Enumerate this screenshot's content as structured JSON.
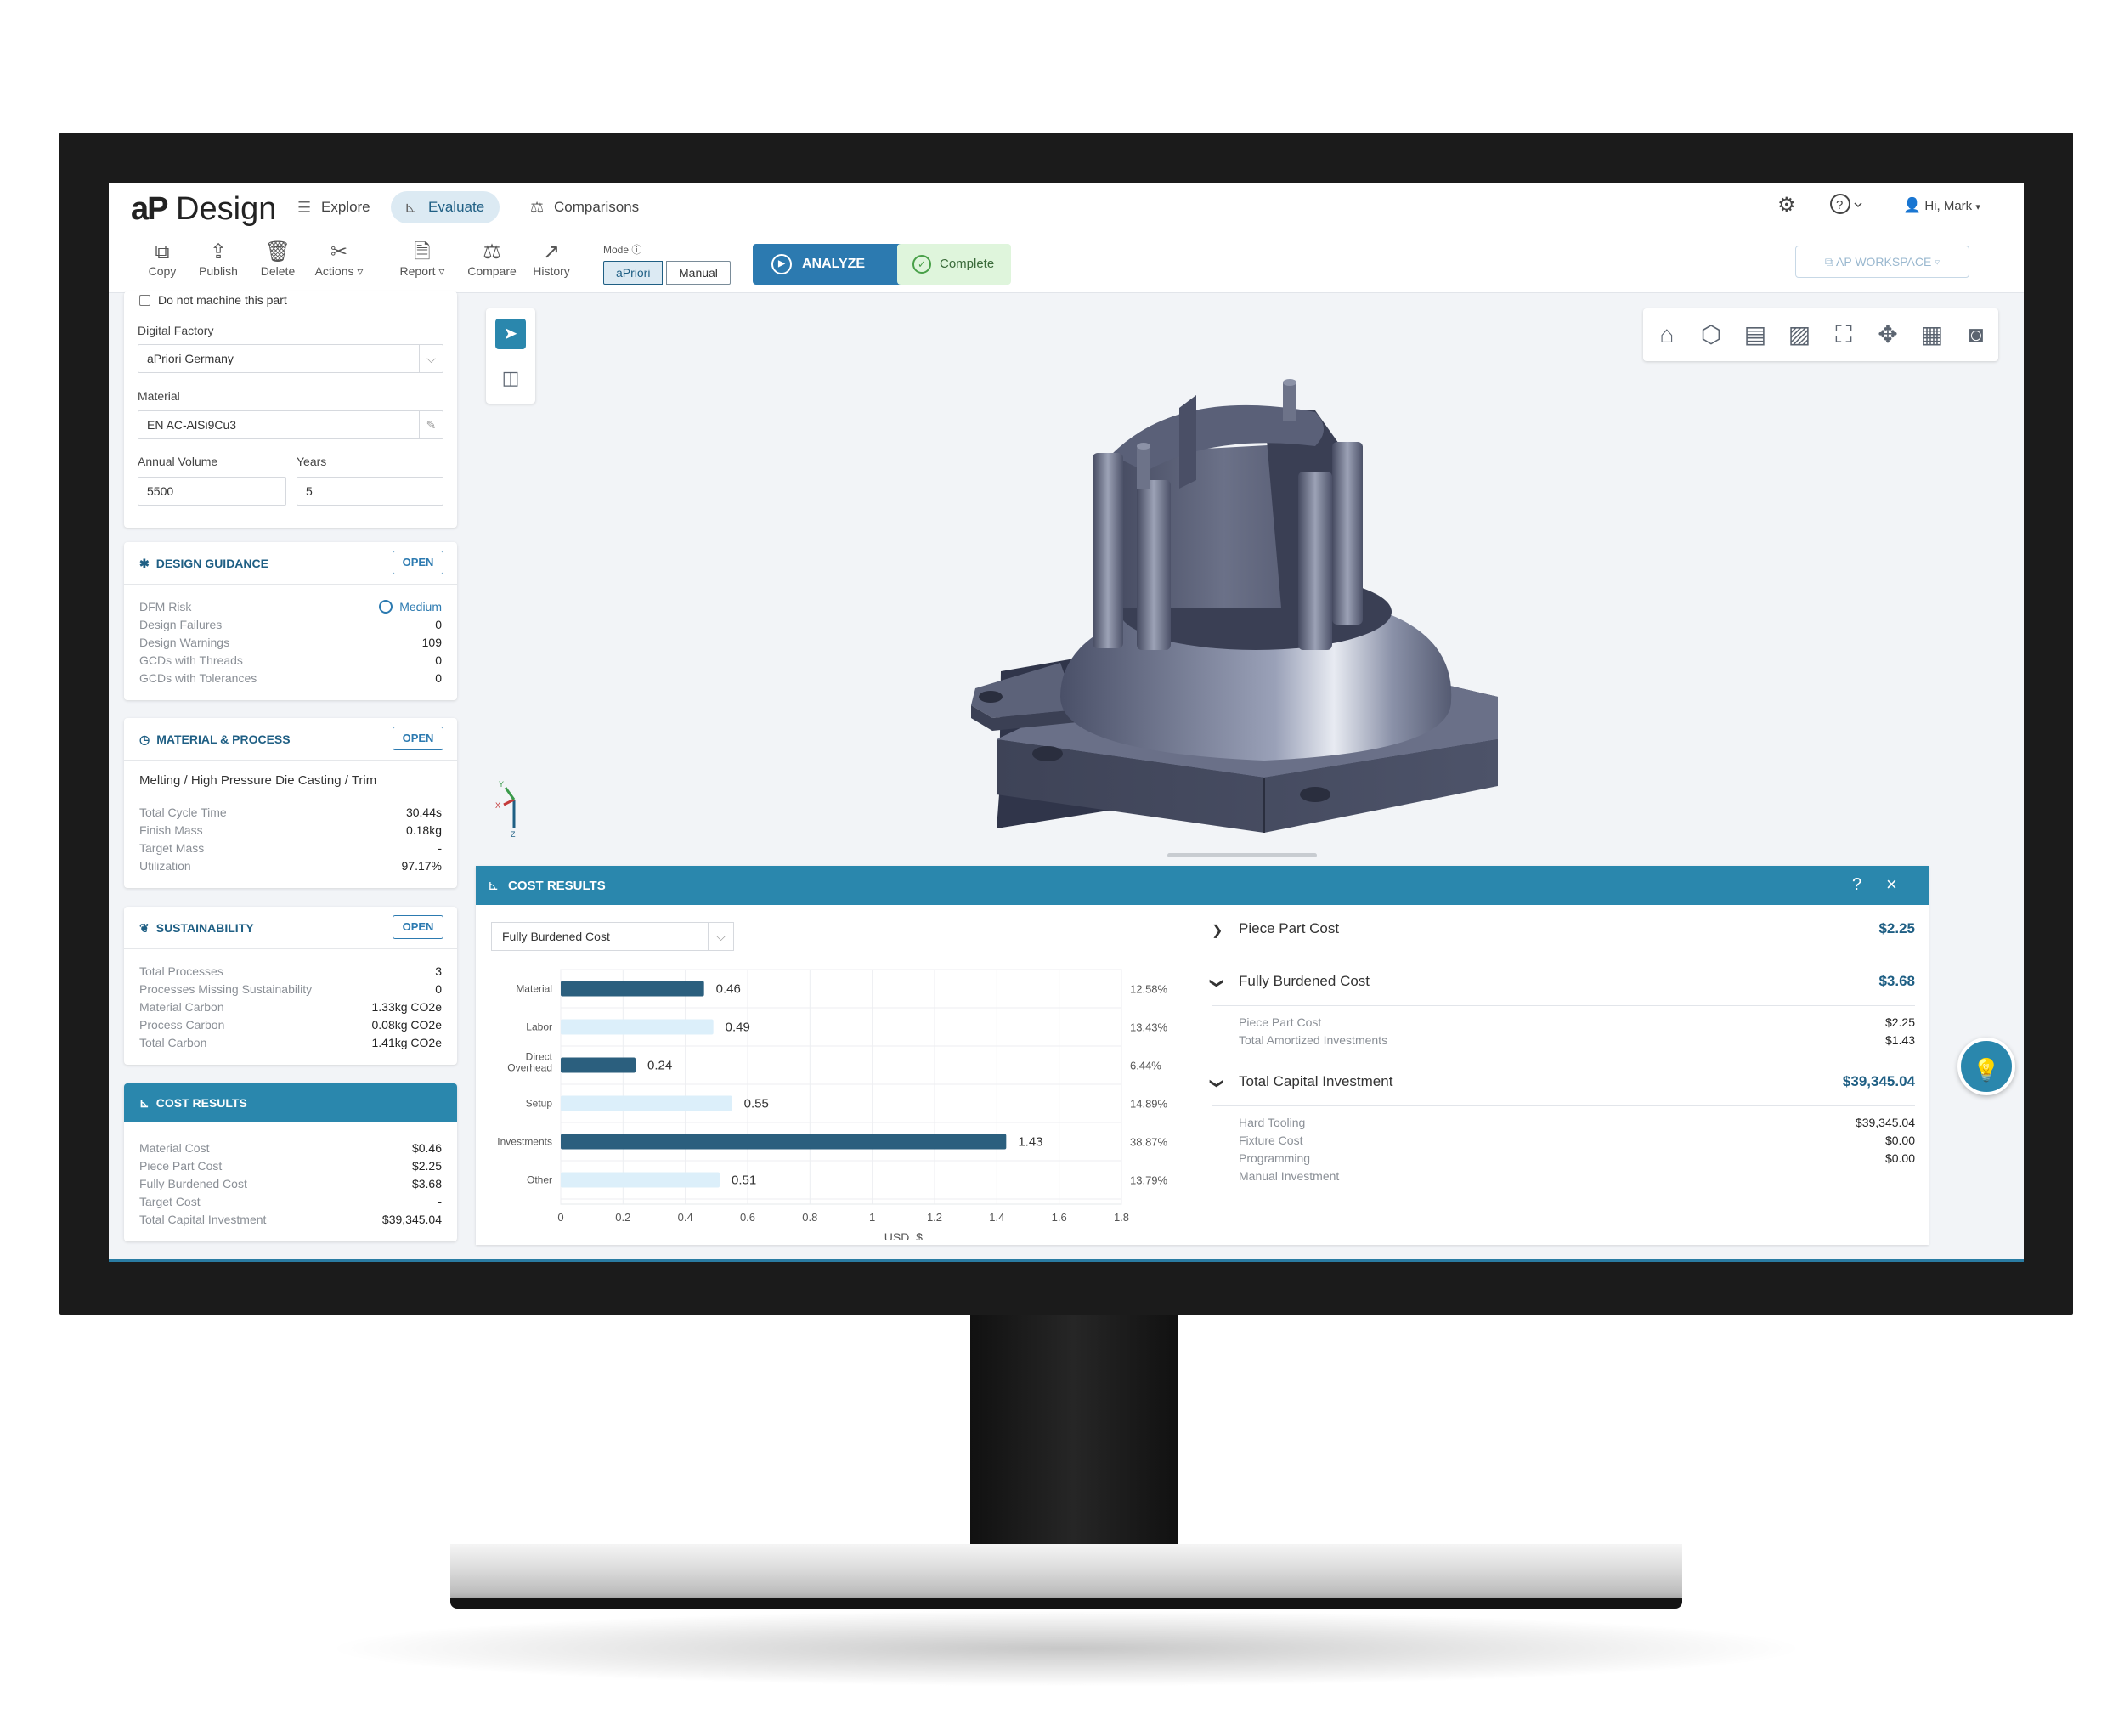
{
  "app": {
    "logo_mark": "aP",
    "logo_text": "Design"
  },
  "nav": {
    "tabs": [
      {
        "label": "Explore",
        "icon": "list-icon"
      },
      {
        "label": "Evaluate",
        "icon": "chart-icon",
        "active": true
      },
      {
        "label": "Comparisons",
        "icon": "scale-icon"
      }
    ],
    "user_label": "Hi, Mark"
  },
  "toolbar": {
    "copy": "Copy",
    "publish": "Publish",
    "delete": "Delete",
    "actions": "Actions",
    "report": "Report",
    "compare": "Compare",
    "history": "History",
    "mode_label": "Mode",
    "mode_options": [
      "aPriori",
      "Manual"
    ],
    "mode_selected": "aPriori",
    "analyze": "ANALYZE",
    "status": "Complete",
    "workspace": "AP WORKSPACE"
  },
  "inputs": {
    "do_not_machine": "Do not machine this part",
    "digital_factory_label": "Digital Factory",
    "digital_factory": "aPriori Germany",
    "material_label": "Material",
    "material": "EN AC-AlSi9Cu3",
    "annual_volume_label": "Annual Volume",
    "annual_volume": "5500",
    "years_label": "Years",
    "years": "5"
  },
  "design_guidance": {
    "title": "DESIGN GUIDANCE",
    "open": "OPEN",
    "rows": [
      {
        "k": "DFM Risk",
        "v": "Medium"
      },
      {
        "k": "Design Failures",
        "v": "0"
      },
      {
        "k": "Design Warnings",
        "v": "109"
      },
      {
        "k": "GCDs with Threads",
        "v": "0"
      },
      {
        "k": "GCDs with Tolerances",
        "v": "0"
      }
    ]
  },
  "material_process": {
    "title": "MATERIAL & PROCESS",
    "open": "OPEN",
    "routing": "Melting / High Pressure Die Casting / Trim",
    "rows": [
      {
        "k": "Total Cycle Time",
        "v": "30.44s"
      },
      {
        "k": "Finish Mass",
        "v": "0.18kg"
      },
      {
        "k": "Target Mass",
        "v": "-"
      },
      {
        "k": "Utilization",
        "v": "97.17%"
      }
    ]
  },
  "sustainability": {
    "title": "SUSTAINABILITY",
    "open": "OPEN",
    "rows": [
      {
        "k": "Total Processes",
        "v": "3"
      },
      {
        "k": "Processes Missing Sustainability",
        "v": "0"
      },
      {
        "k": "Material Carbon",
        "v": "1.33kg CO2e"
      },
      {
        "k": "Process Carbon",
        "v": "0.08kg CO2e"
      },
      {
        "k": "Total Carbon",
        "v": "1.41kg CO2e"
      }
    ]
  },
  "cost_card": {
    "title": "COST RESULTS",
    "rows": [
      {
        "k": "Material Cost",
        "v": "$0.46"
      },
      {
        "k": "Piece Part Cost",
        "v": "$2.25"
      },
      {
        "k": "Fully Burdened Cost",
        "v": "$3.68"
      },
      {
        "k": "Target Cost",
        "v": "-"
      },
      {
        "k": "Total Capital Investment",
        "v": "$39,345.04"
      }
    ]
  },
  "cost_panel": {
    "title": "COST RESULTS",
    "help": "?",
    "close": "×",
    "dropdown": "Fully Burdened Cost",
    "piece_part": {
      "label": "Piece Part Cost",
      "value": "$2.25"
    },
    "fully_burdened": {
      "label": "Fully Burdened Cost",
      "value": "$3.68",
      "rows": [
        {
          "k": "Piece Part Cost",
          "v": "$2.25"
        },
        {
          "k": "Total Amortized Investments",
          "v": "$1.43"
        }
      ]
    },
    "capital": {
      "label": "Total Capital Investment",
      "value": "$39,345.04",
      "rows": [
        {
          "k": "Hard Tooling",
          "v": "$39,345.04"
        },
        {
          "k": "Fixture Cost",
          "v": "$0.00"
        },
        {
          "k": "Programming",
          "v": "$0.00"
        },
        {
          "k": "Manual Investment",
          "v": ""
        }
      ]
    }
  },
  "axis_triad": {
    "x": "X",
    "y": "Y",
    "z": "Z"
  },
  "chart_data": {
    "type": "bar",
    "orientation": "horizontal",
    "categories": [
      "Material",
      "Labor",
      "Direct Overhead",
      "Setup",
      "Investments",
      "Other"
    ],
    "values": [
      0.46,
      0.49,
      0.24,
      0.55,
      1.43,
      0.51
    ],
    "value_labels": [
      "0.46",
      "0.49",
      "0.24",
      "0.55",
      "1.43",
      "0.51"
    ],
    "percent_labels": [
      "12.58%",
      "13.43%",
      "6.44%",
      "14.89%",
      "38.87%",
      "13.79%"
    ],
    "emphasis": [
      true,
      false,
      true,
      false,
      true,
      false
    ],
    "colors": {
      "dark": "#2b5f7e",
      "light": "#dceffa"
    },
    "xlabel": "USD, $",
    "xticks": [
      "0",
      "0.2",
      "0.4",
      "0.6",
      "0.8",
      "1",
      "1.2",
      "1.4",
      "1.6",
      "1.8"
    ],
    "xlim": [
      0,
      1.8
    ],
    "grid": true
  }
}
